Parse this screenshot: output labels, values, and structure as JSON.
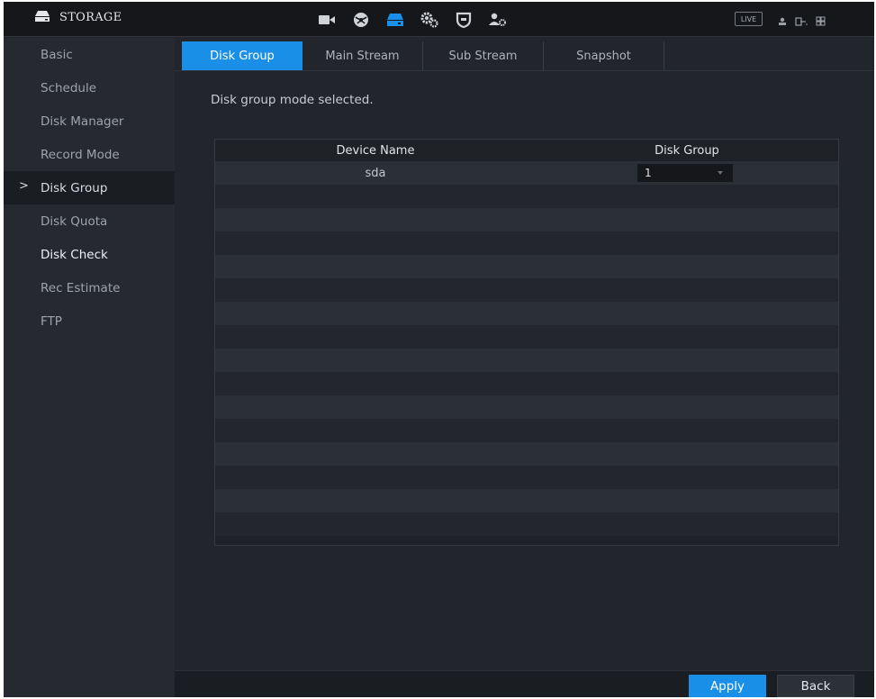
{
  "colors": {
    "accent": "#1a8fe8",
    "background": "#22252b",
    "topbar": "#15171b",
    "sidebar": "#262a30"
  },
  "header": {
    "title": "STORAGE",
    "title_icon": "storage-icon",
    "nav_icons": [
      "camera-icon",
      "network-icon",
      "storage-icon",
      "system-gears-icon",
      "security-shield-icon",
      "account-icon"
    ],
    "active_nav": "storage-icon",
    "live_label": "LIVE",
    "right_icons": [
      "user-icon",
      "logout-icon",
      "settings-grid-icon"
    ]
  },
  "sidebar": {
    "items": [
      {
        "label": "Basic"
      },
      {
        "label": "Schedule"
      },
      {
        "label": "Disk Manager"
      },
      {
        "label": "Record Mode"
      },
      {
        "label": "Disk Group"
      },
      {
        "label": "Disk Quota"
      },
      {
        "label": "Disk Check"
      },
      {
        "label": "Rec Estimate"
      },
      {
        "label": "FTP"
      }
    ],
    "selected": "Disk Group",
    "selected_marker": ">"
  },
  "tabs": [
    {
      "label": "Disk Group"
    },
    {
      "label": "Main Stream"
    },
    {
      "label": "Sub Stream"
    },
    {
      "label": "Snapshot"
    }
  ],
  "active_tab": "Disk Group",
  "main": {
    "hint": "Disk group mode selected.",
    "table": {
      "columns": [
        "Device Name",
        "Disk Group"
      ],
      "rows": [
        {
          "device_name": "sda",
          "disk_group": "1"
        }
      ]
    }
  },
  "footer": {
    "apply_label": "Apply",
    "back_label": "Back"
  }
}
